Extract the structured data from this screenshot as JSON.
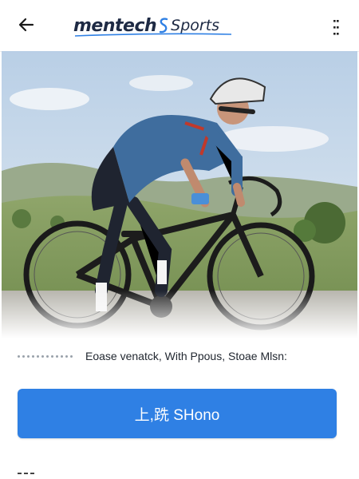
{
  "header": {
    "back_icon": "arrow-left-icon",
    "logo_part1": "mentech",
    "logo_part2": "Sports",
    "menu_icon": "more-vertical-icon"
  },
  "hero": {
    "image_subject": "cyclist-on-road-bike"
  },
  "caption": {
    "text": "Eoase venatck, With Ppous, Stoae Mlsn:"
  },
  "cta": {
    "label": "上,跣 SHono"
  },
  "colors": {
    "brand_dark": "#1e2a44",
    "brand_accent": "#2f80e4",
    "button": "#2f80e4"
  }
}
